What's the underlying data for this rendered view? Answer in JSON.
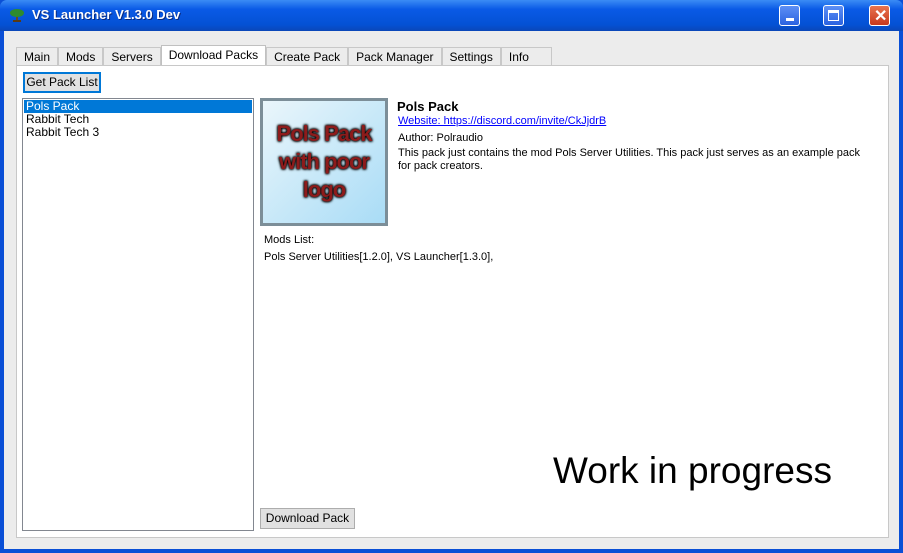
{
  "window": {
    "title": "VS Launcher V1.3.0 Dev"
  },
  "tabs": [
    "Main",
    "Mods",
    "Servers",
    "Download Packs",
    "Create Pack",
    "Pack Manager",
    "Settings",
    "Info"
  ],
  "active_tab": "Download Packs",
  "get_pack_list": "Get Pack List",
  "packs": [
    "Pols Pack",
    "Rabbit Tech",
    "Rabbit Tech 3"
  ],
  "selected_pack": "Pols Pack",
  "details": {
    "name": "Pols Pack",
    "website": "Website: https://discord.com/invite/CkJjdrB",
    "author": "Author: Polraudio",
    "description": "This pack just contains the mod Pols Server Utilities. This pack just serves as an example pack for pack creators.",
    "logo_text": [
      "Pols Pack",
      "with poor",
      "logo"
    ],
    "mods_label": "Mods List:",
    "mods": "Pols Server Utilities[1.2.0], VS Launcher[1.3.0],"
  },
  "wip": "Work in progress",
  "download": "Download Pack"
}
